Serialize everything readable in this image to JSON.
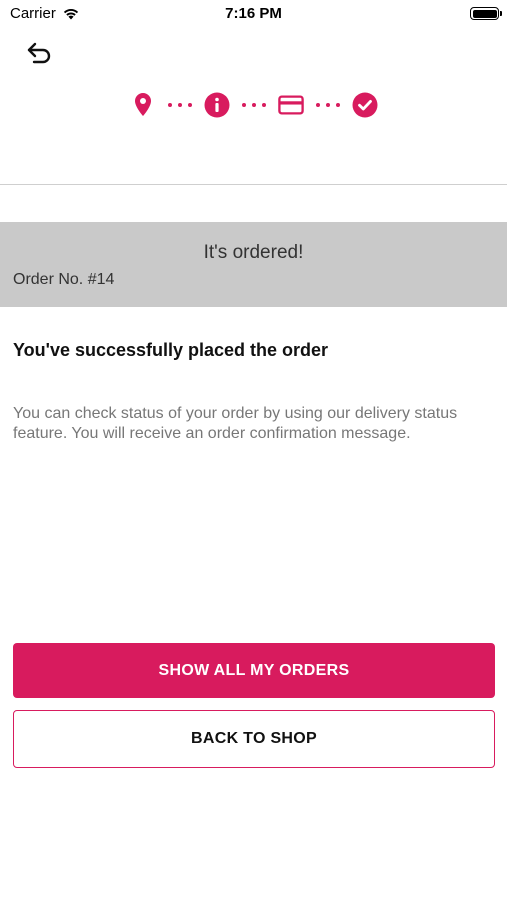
{
  "status_bar": {
    "carrier": "Carrier",
    "time": "7:16 PM"
  },
  "stepper": {
    "steps": [
      "location-pin-icon",
      "info-icon",
      "credit-card-icon",
      "check-circle-icon"
    ],
    "accent_color": "#d81b5e"
  },
  "banner": {
    "title": "It's ordered!",
    "order_number": "Order No. #14"
  },
  "confirmation": {
    "headline": "You've successfully placed the order",
    "message": "You can check status of your order by using our delivery status feature. You will receive an order confirmation message."
  },
  "actions": {
    "primary_label": "SHOW ALL MY ORDERS",
    "secondary_label": "BACK TO SHOP"
  }
}
